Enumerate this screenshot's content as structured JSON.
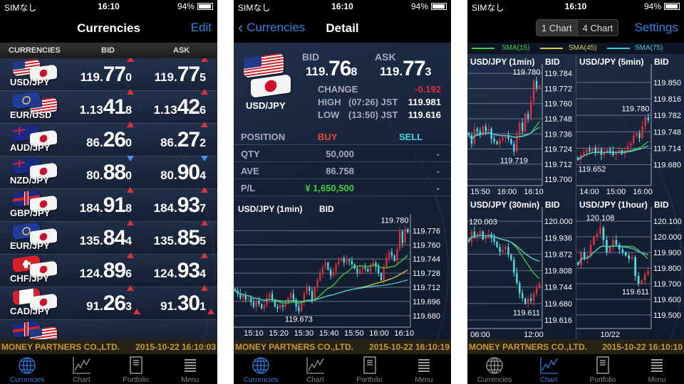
{
  "status_bar": {
    "carrier": "SIMなし",
    "time": "16:10",
    "battery": "94%"
  },
  "colors": {
    "accent": "#2a86e6",
    "up": "#e0303a",
    "down_candle": "#4fe0e8",
    "sma15": "#3fcf3f",
    "sma45": "#d8d040",
    "sma75": "#3cc8d8",
    "footer_text": "#c99a2a",
    "buy": "#e84a3a",
    "sell": "#3cd8e0",
    "pl": "#3ccf3c",
    "change": "#e0303a"
  },
  "tabs": [
    {
      "label": "Currencies",
      "icon": "globe-icon"
    },
    {
      "label": "Chart",
      "icon": "chart-line-icon"
    },
    {
      "label": "Portfolio",
      "icon": "document-icon"
    },
    {
      "label": "Menu",
      "icon": "list-icon"
    }
  ],
  "company": "MONEY PARTNERS  CO.,LTD.",
  "currencies_screen": {
    "title": "Currencies",
    "edit": "Edit",
    "headers": {
      "pair": "CURRENCIES",
      "bid": "BID",
      "ask": "ASK"
    },
    "timestamp": "2015-10-22 16:10:03",
    "rows": [
      {
        "pair": "USD/JPY",
        "flags": [
          "USD",
          "JPY"
        ],
        "bid": {
          "pre": "119.",
          "big": "77",
          "sm": "0",
          "dir": "up"
        },
        "ask": {
          "pre": "119.",
          "big": "77",
          "sm": "5",
          "dir": "up"
        }
      },
      {
        "pair": "EUR/USD",
        "flags": [
          "EUR",
          "USD"
        ],
        "bid": {
          "pre": "1.13",
          "big": "41",
          "sm": "8",
          "dir": "up"
        },
        "ask": {
          "pre": "1.13",
          "big": "42",
          "sm": "6",
          "dir": "up"
        }
      },
      {
        "pair": "AUD/JPY",
        "flags": [
          "AUD",
          "JPY"
        ],
        "bid": {
          "pre": "86.",
          "big": "26",
          "sm": "0",
          "dir": "up"
        },
        "ask": {
          "pre": "86.",
          "big": "27",
          "sm": "2",
          "dir": "up"
        }
      },
      {
        "pair": "NZD/JPY",
        "flags": [
          "NZD",
          "JPY"
        ],
        "bid": {
          "pre": "80.",
          "big": "88",
          "sm": "0",
          "dir": "down"
        },
        "ask": {
          "pre": "80.",
          "big": "90",
          "sm": "4",
          "dir": "down"
        }
      },
      {
        "pair": "GBP/JPY",
        "flags": [
          "GBP",
          "JPY"
        ],
        "bid": {
          "pre": "184.",
          "big": "91",
          "sm": "8",
          "dir": "up"
        },
        "ask": {
          "pre": "184.",
          "big": "93",
          "sm": "7",
          "dir": "up"
        }
      },
      {
        "pair": "EUR/JPY",
        "flags": [
          "EUR",
          "JPY"
        ],
        "bid": {
          "pre": "135.",
          "big": "84",
          "sm": "4",
          "dir": "up"
        },
        "ask": {
          "pre": "135.",
          "big": "85",
          "sm": "5",
          "dir": "up"
        }
      },
      {
        "pair": "CHF/JPY",
        "flags": [
          "CHF",
          "JPY"
        ],
        "bid": {
          "pre": "124.",
          "big": "89",
          "sm": "6",
          "dir": "up"
        },
        "ask": {
          "pre": "124.",
          "big": "93",
          "sm": "4",
          "dir": "up"
        }
      },
      {
        "pair": "CAD/JPY",
        "flags": [
          "CAD",
          "JPY"
        ],
        "bid": {
          "pre": "91.",
          "big": "26",
          "sm": "3",
          "dir": "up"
        },
        "ask": {
          "pre": "91.",
          "big": "30",
          "sm": "1",
          "dir": "up"
        }
      },
      {
        "pair": "",
        "flags": [
          "GBP",
          "USD"
        ],
        "bid": {
          "pre": "",
          "big": "",
          "sm": "",
          "dir": "up"
        },
        "ask": {
          "pre": "",
          "big": "",
          "sm": "",
          "dir": "up"
        }
      }
    ]
  },
  "detail_screen": {
    "back": "Currencies",
    "title": "Detail",
    "pair": "USD/JPY",
    "bid_label": "BID",
    "bid": {
      "pre": "119.",
      "big": "76",
      "sm": "8"
    },
    "ask_label": "ASK",
    "ask": {
      "pre": "119.",
      "big": "77",
      "sm": "3"
    },
    "change_label": "CHANGE",
    "change": "-0.192",
    "high_label": "HIGH",
    "high_time": "(07:26) JST",
    "high": "119.981",
    "low_label": "LOW",
    "low_time": "(13:50) JST",
    "low": "119.616",
    "position": {
      "label": "POSITION",
      "buy": "BUY",
      "sell": "SELL",
      "rows": [
        {
          "label": "QTY",
          "buy": "50,000",
          "sell": "-"
        },
        {
          "label": "AVE",
          "buy": "86.758",
          "sell": "-"
        },
        {
          "label": "P/L",
          "buy": "¥ 1,650,500",
          "sell": "-"
        }
      ]
    },
    "timestamp": "2015-10-22 16:10:19"
  },
  "chart_screen": {
    "seg": [
      "1 Chart",
      "4 Chart"
    ],
    "settings": "Settings",
    "legend": [
      "SMA(15)",
      "SMA(45)",
      "SMA(75)"
    ],
    "timestamp": "2015-10-22 16:10:10"
  },
  "chart_data": [
    {
      "type": "candlestick",
      "title": "USD/JPY (1min)",
      "price": "BID",
      "ylim": [
        119.667,
        119.79
      ],
      "y_ticks": [
        "119.776",
        "119.760",
        "119.744",
        "119.728",
        "119.712",
        "119.696",
        "119.680"
      ],
      "x_ticks": [
        "15:10",
        "15:20",
        "15:30",
        "15:40",
        "15:50",
        "16:00",
        "16:10"
      ],
      "high_label": "119.780",
      "low_label": "119.673",
      "closes": [
        119.708,
        119.705,
        119.7,
        119.703,
        119.698,
        119.7,
        119.695,
        119.69,
        119.697,
        119.693,
        119.688,
        119.692,
        119.7,
        119.705,
        119.698,
        119.69,
        119.688,
        119.692,
        119.69,
        119.694,
        119.7,
        119.705,
        119.698,
        119.69,
        119.685,
        119.695,
        119.705,
        119.712,
        119.708,
        119.697,
        119.712,
        119.72,
        119.728,
        119.735,
        119.74,
        119.732,
        119.725,
        119.73,
        119.738,
        119.742,
        119.745,
        119.74,
        119.743,
        119.742,
        119.738,
        119.733,
        119.728,
        119.732,
        119.735,
        119.733,
        119.73,
        119.736,
        119.74,
        119.735,
        119.728,
        119.72,
        119.735,
        119.745,
        119.752,
        119.748,
        119.742,
        119.755,
        119.775,
        119.762,
        119.778,
        119.774
      ]
    },
    {
      "type": "candlestick",
      "title": "USD/JPY (1min)",
      "price": "BID",
      "ylim": [
        119.695,
        119.788
      ],
      "y_ticks": [
        "119.784",
        "119.772",
        "119.760",
        "119.748",
        "119.736",
        "119.724",
        "119.712",
        "119.700"
      ],
      "x_ticks": [
        "15:50",
        "16:00",
        "16:10"
      ],
      "high_label": "119.780",
      "low_label": "119.719",
      "closes": [
        119.735,
        119.728,
        119.74,
        119.738,
        119.735,
        119.742,
        119.738,
        119.74,
        119.732,
        119.73,
        119.728,
        119.731,
        119.733,
        119.735,
        119.732,
        119.728,
        119.722,
        119.735,
        119.745,
        119.738,
        119.752,
        119.748,
        119.762,
        119.778,
        119.772,
        119.774
      ]
    },
    {
      "type": "candlestick",
      "title": "USD/JPY (5min)",
      "price": "BID",
      "ylim": [
        119.637,
        119.879
      ],
      "y_ticks": [
        "119.850",
        "119.816",
        "119.782",
        "119.748",
        "119.714",
        "119.680"
      ],
      "x_ticks": [
        "14:00",
        "15:00",
        "16:00"
      ],
      "high_label": "119.780",
      "low_label": "119.652",
      "closes": [
        119.69,
        119.7,
        119.705,
        119.712,
        119.708,
        119.715,
        119.705,
        119.712,
        119.7,
        119.705,
        119.712,
        119.708,
        119.7,
        119.705,
        119.71,
        119.702,
        119.71,
        119.718,
        119.725,
        119.74,
        119.745,
        119.735,
        119.76,
        119.778,
        119.772
      ]
    },
    {
      "type": "candlestick",
      "title": "USD/JPY (30min)",
      "price": "BID",
      "ylim": [
        119.583,
        120.039
      ],
      "y_ticks": [
        "120.000",
        "119.936",
        "119.872",
        "119.808",
        "119.744",
        "119.680",
        "119.616"
      ],
      "x_ticks": [
        "06:00",
        "12:00"
      ],
      "high_label": "120.003",
      "low_label": "119.611",
      "closes": [
        119.92,
        119.96,
        119.94,
        119.95,
        119.96,
        119.93,
        119.94,
        119.95,
        119.935,
        119.92,
        119.9,
        119.88,
        119.89,
        119.9,
        119.87,
        119.85,
        119.8,
        119.76,
        119.72,
        119.7,
        119.68,
        119.7,
        119.69,
        119.72,
        119.74,
        119.76
      ]
    },
    {
      "type": "candlestick",
      "title": "USD/JPY (1hour)",
      "price": "BID",
      "ylim": [
        119.413,
        120.164
      ],
      "y_ticks": [
        "120.100",
        "120.000",
        "119.900",
        "119.800",
        "119.700",
        "119.600",
        "119.500"
      ],
      "x_ticks": [
        "10/22"
      ],
      "high_label": "120.108",
      "low_label": "119.611",
      "closes": [
        119.82,
        119.9,
        119.86,
        119.88,
        119.95,
        120.0,
        120.02,
        120.06,
        119.98,
        119.9,
        119.94,
        119.98,
        119.95,
        119.92,
        119.9,
        119.88,
        119.86,
        119.87,
        119.75,
        119.7,
        119.72,
        119.76,
        119.78
      ]
    }
  ]
}
